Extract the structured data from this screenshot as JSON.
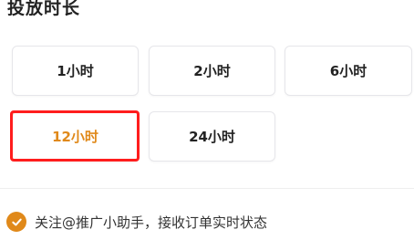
{
  "section": {
    "title": "投放时长"
  },
  "options": [
    {
      "label": "1小时",
      "selected": false
    },
    {
      "label": "2小时",
      "selected": false
    },
    {
      "label": "6小时",
      "selected": false
    },
    {
      "label": "12小时",
      "selected": true
    },
    {
      "label": "24小时",
      "selected": false
    }
  ],
  "follow": {
    "checked": true,
    "text": "关注@推广小助手，接收订单实时状态",
    "icon": "checkmark-icon"
  },
  "colors": {
    "accent": "#e0891a",
    "highlight": "#ff1d1d"
  }
}
